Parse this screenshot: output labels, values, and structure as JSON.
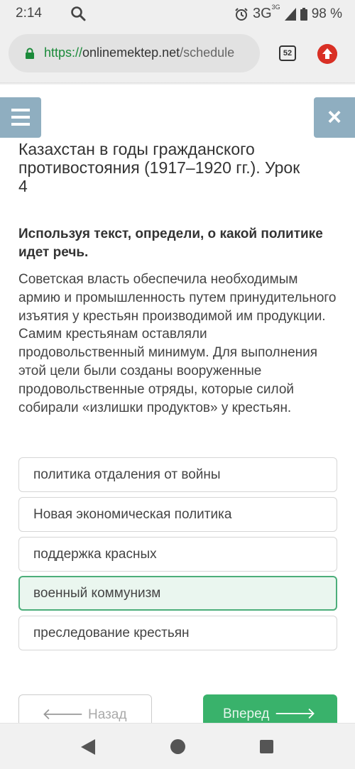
{
  "status_bar": {
    "time": "2:14",
    "network": "3G",
    "network_sup": "3G",
    "battery": "98 %"
  },
  "browser": {
    "url_scheme": "https://",
    "url_host": "onlinemektep.net",
    "url_path": "/schedule",
    "tab_count": "52"
  },
  "lesson": {
    "title": "Казахстан в годы гражданского противостояния (1917–1920 гг.). Урок 4",
    "question": "Используя текст, определи, о какой политике идет речь.",
    "passage": "Советская власть обеспечила необходимым армию и промышленность путем принудительного изъятия у крестьян производимой им продукции. Самим крестьянам оставляли продовольственный минимум. Для выполнения этой цели были созданы вооруженные продовольственные отряды, которые силой собирали «излишки продуктов» у крестьян."
  },
  "options": [
    {
      "label": "политика отдаления от войны",
      "selected": false
    },
    {
      "label": "Новая экономическая политика",
      "selected": false
    },
    {
      "label": "поддержка красных",
      "selected": false
    },
    {
      "label": "военный коммунизм",
      "selected": true
    },
    {
      "label": "преследование крестьян",
      "selected": false
    }
  ],
  "navigation": {
    "back_label": "Назад",
    "next_label": "Вперед"
  },
  "colors": {
    "accent_green": "#39b26b",
    "selected_bg": "#eaf6ef",
    "menu_blue": "#8faec0",
    "update_red": "#d93025"
  },
  "icons": [
    "search-icon",
    "alarm-icon",
    "signal-icon",
    "battery-icon",
    "lock-icon",
    "tabs-icon",
    "update-icon",
    "menu-icon",
    "close-icon",
    "arrow-left-icon",
    "arrow-right-icon",
    "nav-back-icon",
    "nav-home-icon",
    "nav-recent-icon"
  ]
}
